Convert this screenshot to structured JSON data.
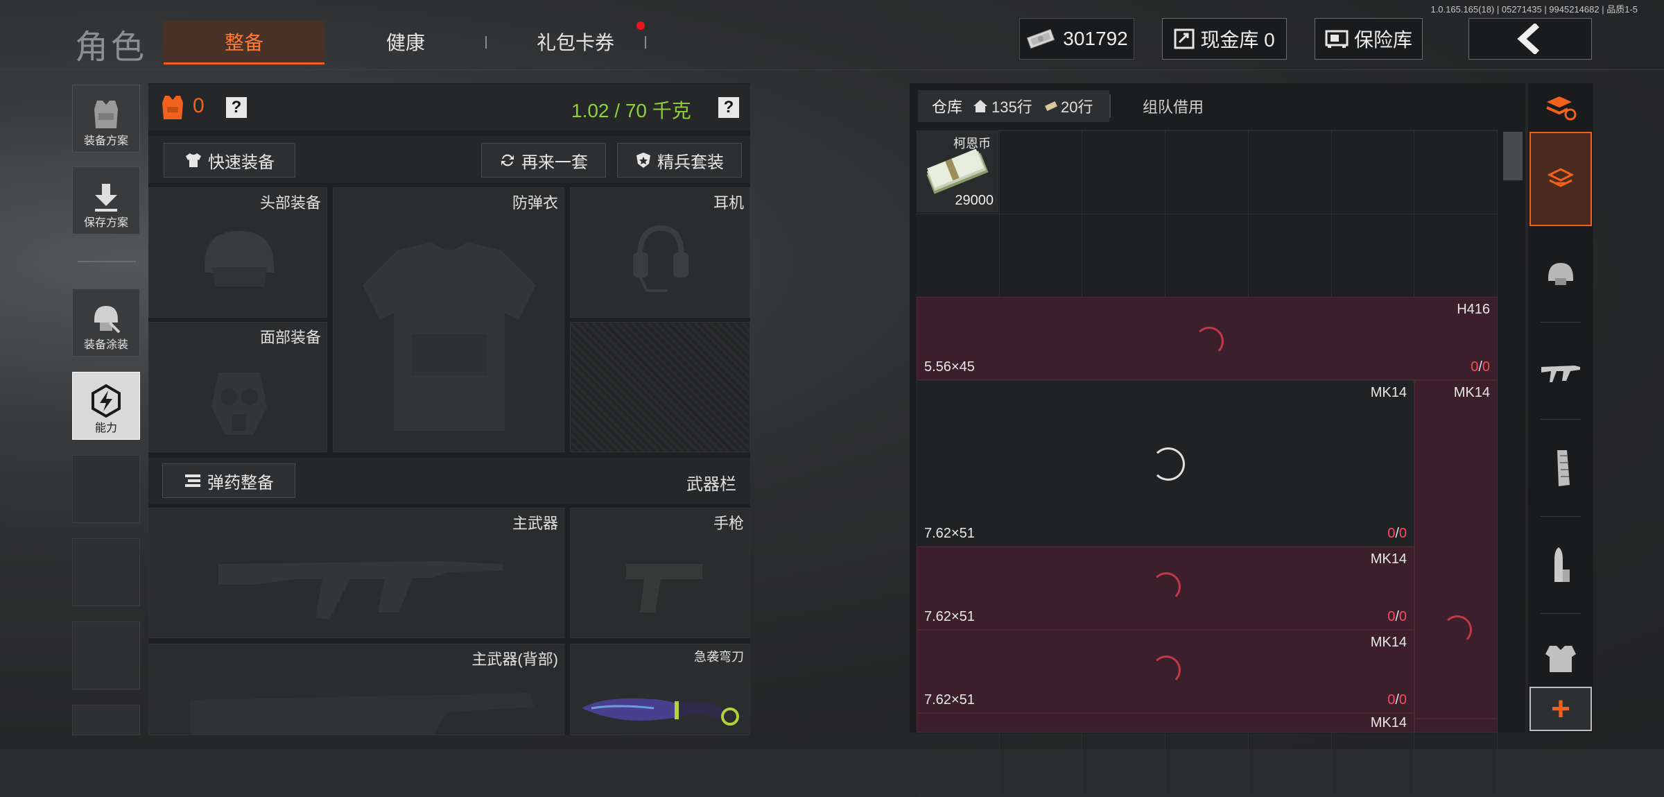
{
  "header": {
    "title": "角色",
    "tabs": [
      {
        "label": "整备",
        "active": true
      },
      {
        "label": "健康"
      },
      {
        "label": "礼包卡券",
        "notification": true
      }
    ],
    "version": "1.0.165.165(18) | 05271435 | 9945214682 | 品质1-5",
    "money": "301792",
    "cash_vault": "现金库 0",
    "safe": "保险库",
    "accent": "#f2621e"
  },
  "sidebar": {
    "items": [
      {
        "label": "装备方案",
        "icon": "vest-plan-icon"
      },
      {
        "label": "保存方案",
        "icon": "download-icon"
      },
      {
        "label": "装备涂装",
        "icon": "helmet-skin-icon"
      },
      {
        "label": "能力",
        "icon": "lightning-icon",
        "active": true
      }
    ]
  },
  "equip": {
    "armor_count": "0",
    "help": "?",
    "weight": "1.02 / 70 千克",
    "quick_equip": "快速装备",
    "again": "再来一套",
    "elite": "精兵套装",
    "slots": {
      "head": "头部装备",
      "vest": "防弹衣",
      "headset": "耳机",
      "face": "面部装备"
    },
    "ammo_btn": "弹药整备",
    "weapon_bar": "武器栏",
    "primary": "主武器",
    "pistol": "手枪",
    "primary_back": "主武器(背部)",
    "melee": "急袭弯刀"
  },
  "warehouse": {
    "tabs": {
      "storage": "仓库",
      "rows1": "135行",
      "rows2": "20行",
      "team": "组队借用"
    },
    "coin": {
      "name": "柯恩币",
      "count": "29000"
    },
    "items": [
      {
        "name": "H416",
        "ammo": "5.56×45",
        "loaded": "0",
        "total": "0"
      },
      {
        "name": "MK14",
        "ammo": "7.62×51",
        "loaded": "0",
        "total": "0"
      },
      {
        "name": "MK14"
      },
      {
        "name": "MK14",
        "ammo": "7.62×51",
        "loaded": "0",
        "total": "0"
      },
      {
        "name": "MK14",
        "ammo": "7.62×51",
        "loaded": "0",
        "total": "0"
      },
      {
        "name": "MK14"
      }
    ]
  },
  "rail": {
    "icons": [
      "sort-refresh-icon",
      "all-items-icon",
      "helmet-icon",
      "rifle-icon",
      "magazine-icon",
      "ammo-icon",
      "armor-icon"
    ],
    "add": "+"
  }
}
